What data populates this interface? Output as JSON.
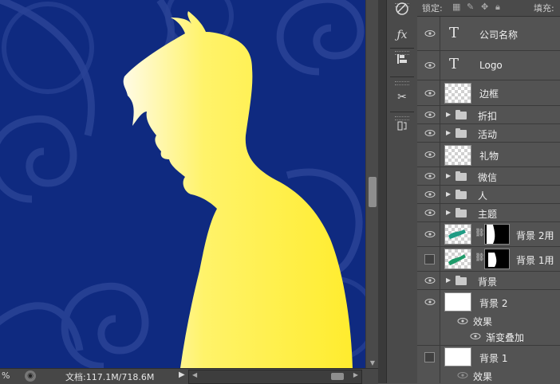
{
  "statusbar": {
    "zoom": "%",
    "doc_info": "文档:117.1M/718.6M"
  },
  "layers_panel": {
    "lock_label": "锁定:",
    "fill_label": "填充:",
    "layers": [
      {
        "name": "公司名称",
        "type": "text",
        "visible": true
      },
      {
        "name": "Logo",
        "type": "text",
        "visible": true
      },
      {
        "name": "边框",
        "type": "pixel",
        "visible": true
      },
      {
        "name": "折扣",
        "type": "group",
        "visible": true
      },
      {
        "name": "活动",
        "type": "group",
        "visible": true
      },
      {
        "name": "礼物",
        "type": "pixel",
        "visible": true
      },
      {
        "name": "微信",
        "type": "group",
        "visible": true
      },
      {
        "name": "人",
        "type": "group",
        "visible": true
      },
      {
        "name": "主题",
        "type": "group",
        "visible": true
      },
      {
        "name": "背景 2用",
        "type": "masked",
        "visible": true
      },
      {
        "name": "背景 1用",
        "type": "masked",
        "visible": false
      },
      {
        "name": "背景",
        "type": "group",
        "visible": true
      },
      {
        "name": "背景 2",
        "type": "pixel",
        "visible": true
      },
      {
        "name": "效果",
        "type": "effects",
        "visible": true
      },
      {
        "name": "渐变叠加",
        "type": "effect",
        "visible": true
      },
      {
        "name": "背景 1",
        "type": "pixel",
        "visible": false
      },
      {
        "name": "效果",
        "type": "effects",
        "visible": true
      }
    ]
  },
  "tools": [
    "brush-settings-icon",
    "fx-icon",
    "align-icon",
    "scissors-tool-icon",
    "history-icon"
  ],
  "colors": {
    "canvas_bg": "#0f2a80",
    "silhouette": "#ffef3a",
    "panel_bg": "#535353"
  }
}
